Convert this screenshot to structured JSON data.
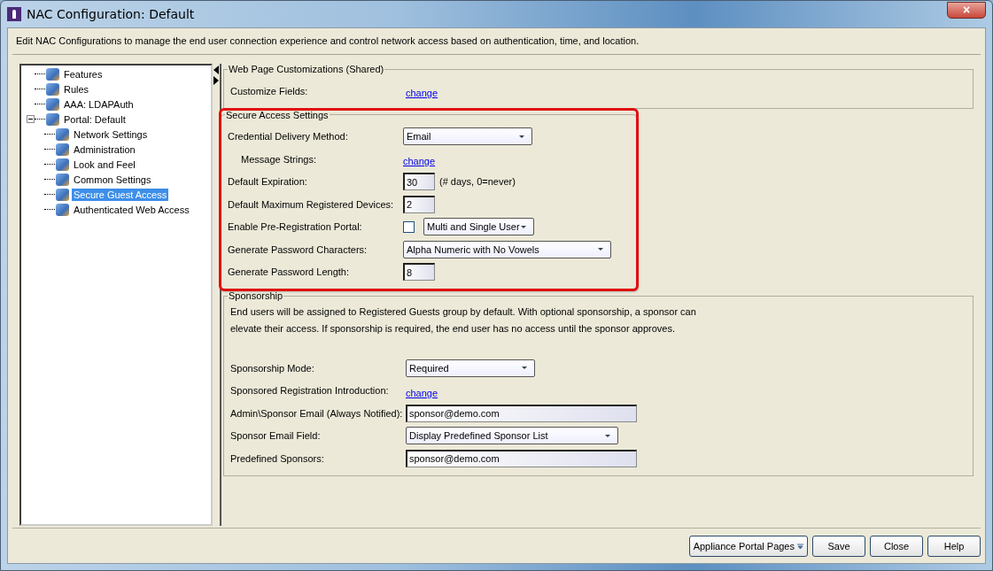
{
  "window": {
    "title": "NAC Configuration: Default",
    "close_label": "×"
  },
  "description": "Edit NAC Configurations to manage the end user connection experience and control network access based on authentication, time, and location.",
  "tree": [
    {
      "label": "Features",
      "selected": false
    },
    {
      "label": "Rules",
      "selected": false
    },
    {
      "label": "AAA: LDAPAuth",
      "selected": false
    },
    {
      "label": "Portal: Default",
      "selected": false,
      "expanded": true,
      "children": [
        {
          "label": "Network Settings",
          "selected": false
        },
        {
          "label": "Administration",
          "selected": false
        },
        {
          "label": "Look and Feel",
          "selected": false
        },
        {
          "label": "Common Settings",
          "selected": false
        },
        {
          "label": "Secure Guest Access",
          "selected": true
        },
        {
          "label": "Authenticated Web Access",
          "selected": false
        }
      ]
    }
  ],
  "sections": [
    {
      "title": "Web Page Customizations (Shared)",
      "highlighted": false,
      "rows": [
        {
          "kind": "link",
          "label": "Customize Fields:",
          "value": "change"
        }
      ]
    },
    {
      "title": "Secure Access Settings",
      "highlighted": true,
      "rows": [
        {
          "kind": "select",
          "label": "Credential Delivery Method:",
          "value": "Email"
        },
        {
          "kind": "link",
          "label": "Message Strings:",
          "value": "change",
          "indent": true
        },
        {
          "kind": "text",
          "label": "Default Expiration:",
          "value": "30",
          "note": "(# days, 0=never)"
        },
        {
          "kind": "text",
          "label": "Default Maximum Registered Devices:",
          "value": "2"
        },
        {
          "kind": "checkbox-select",
          "label": "Enable Pre-Registration Portal:",
          "checked": false,
          "value": "Multi and Single User"
        },
        {
          "kind": "select",
          "label": "Generate Password Characters:",
          "value": "Alpha Numeric with No Vowels"
        },
        {
          "kind": "text",
          "label": "Generate Password Length:",
          "value": "8"
        }
      ]
    },
    {
      "title": "Sponsorship",
      "highlighted": false,
      "intro": "End users will be assigned to Registered Guests group by default. With optional sponsorship, a sponsor can elevate their access. If sponsorship is required, the end user has no access until the sponsor approves.",
      "rows": [
        {
          "kind": "select",
          "label": "Sponsorship Mode:",
          "value": "Required"
        },
        {
          "kind": "link",
          "label": "Sponsored Registration Introduction:",
          "value": "change"
        },
        {
          "kind": "text",
          "label": "Admin\\Sponsor Email (Always Notified):",
          "value": "sponsor@demo.com"
        },
        {
          "kind": "select",
          "label": "Sponsor Email Field:",
          "value": "Display Predefined Sponsor List"
        },
        {
          "kind": "text",
          "label": "Predefined Sponsors:",
          "value": "sponsor@demo.com"
        }
      ]
    }
  ],
  "buttons": [
    {
      "label": "Appliance Portal Pages",
      "menu": true
    },
    {
      "label": "Save",
      "menu": false
    },
    {
      "label": "Close",
      "menu": false
    },
    {
      "label": "Help",
      "menu": false
    }
  ]
}
